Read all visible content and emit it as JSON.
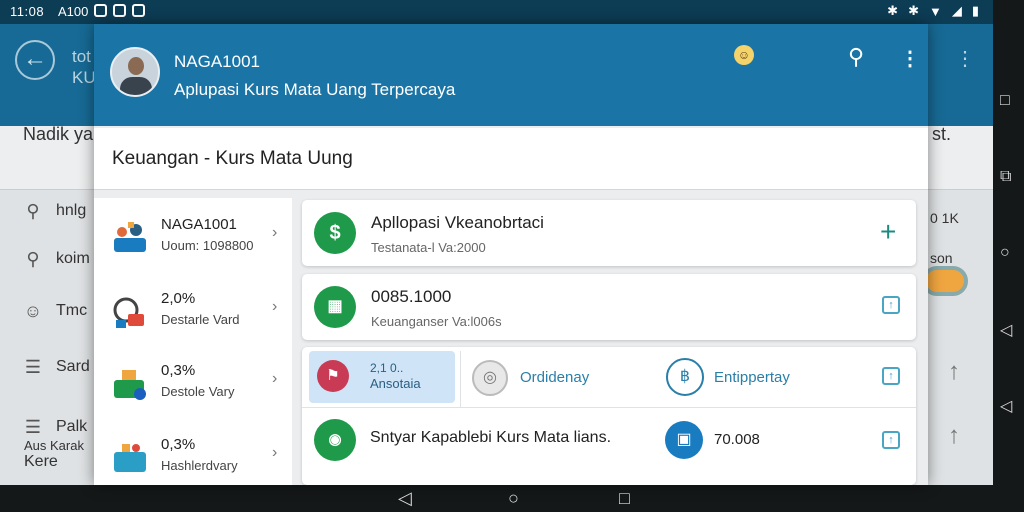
{
  "status_bar": {
    "time": "11:08",
    "carrier": "A100"
  },
  "background_app": {
    "title_line1": "tot",
    "title_line2": "KU",
    "search_text": "Nadik ya",
    "search_right": "st.",
    "items": [
      {
        "icon": "search-icon",
        "label": "hnlg"
      },
      {
        "icon": "search-icon",
        "label": "koim"
      },
      {
        "icon": "chat-icon",
        "label": "Tmc"
      },
      {
        "icon": "list-icon",
        "label": "Sard"
      },
      {
        "icon": "list-icon",
        "label": "Palk"
      }
    ],
    "right_texts": [
      "0   1K",
      "son"
    ],
    "bottom_left_line1": "Aus   Karak",
    "bottom_left_line2": "Kere"
  },
  "dialog": {
    "header": {
      "name": "NAGA1001",
      "subtitle": "Aplupasi Kurs Mata Uang Terpercaya"
    },
    "section_title": "Keuangan - Kurs Mata Uung",
    "left_items": [
      {
        "title": "NAGA1001",
        "subtitle": "Uoum: 1098800"
      },
      {
        "title": "2,0%",
        "subtitle": "Destarle Vard"
      },
      {
        "title": "0,3%",
        "subtitle": "Destole Vary"
      },
      {
        "title": "0,3%",
        "subtitle": "Hashlerdvary"
      }
    ],
    "cards": [
      {
        "title": "Apllopasi Vkeanobrtaci",
        "subtitle": "Testanata-l Va:2000"
      },
      {
        "title": "0085.1000",
        "subtitle": "Keuanganser Va:l006s"
      }
    ],
    "tabs": [
      {
        "line1": "2,1 0..",
        "line2": "Ansotaia"
      },
      {
        "label": "Ordidenay"
      },
      {
        "label": "Entippertay"
      }
    ],
    "bottom_row": {
      "text": "Sntyar Kapablebi Kurs Mata lians.",
      "value": "70.008"
    }
  },
  "colors": {
    "header_blue": "#1a75a6",
    "accent_green": "#1e9a4a",
    "status_bar": "#0d3c55"
  }
}
